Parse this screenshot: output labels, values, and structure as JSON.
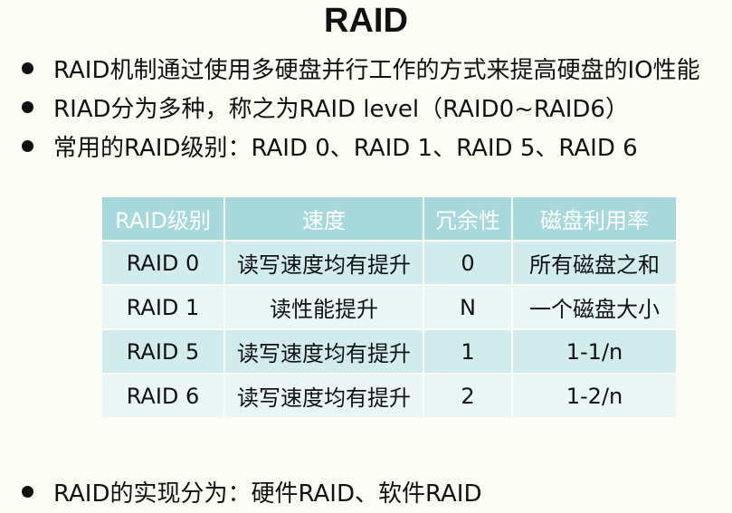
{
  "title": "RAID",
  "bullets": [
    "RAID机制通过使用多硬盘并行工作的方式来提高硬盘的IO性能",
    "RIAD分为多种，称之为RAID level（RAID0~RAID6）",
    "常用的RAID级别：RAID 0、RAID 1、RAID 5、RAID 6"
  ],
  "table": {
    "headers": [
      "RAID级别",
      "速度",
      "冗余性",
      "磁盘利用率"
    ],
    "rows": [
      [
        "RAID 0",
        "读写速度均有提升",
        "0",
        "所有磁盘之和"
      ],
      [
        "RAID 1",
        "读性能提升",
        "N",
        "一个磁盘大小"
      ],
      [
        "RAID 5",
        "读写速度均有提升",
        "1",
        "1-1/n"
      ],
      [
        "RAID 6",
        "读写速度均有提升",
        "2",
        "1-2/n"
      ]
    ]
  },
  "bottom_bullet": "RAID的实现分为：硬件RAID、软件RAID"
}
